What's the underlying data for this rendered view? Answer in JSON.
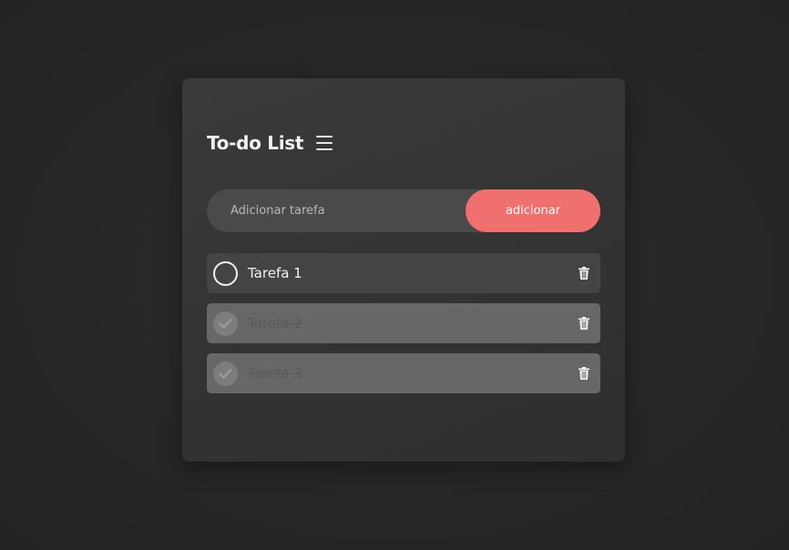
{
  "app": {
    "title": "To-do List"
  },
  "add_task": {
    "placeholder": "Adicionar tarefa",
    "value": "",
    "button_label": "adicionar"
  },
  "tasks": [
    {
      "label": "Tarefa 1",
      "done": false
    },
    {
      "label": "Tarefa 2",
      "done": true
    },
    {
      "label": "Tarefa 3",
      "done": true
    }
  ],
  "icons": {
    "menu": "hamburger-menu-icon",
    "check_empty": "circle-icon",
    "check_done": "checkmark-icon",
    "delete": "trash-icon"
  },
  "colors": {
    "accent": "#f07070",
    "card": "#363636",
    "background": "#262626"
  }
}
